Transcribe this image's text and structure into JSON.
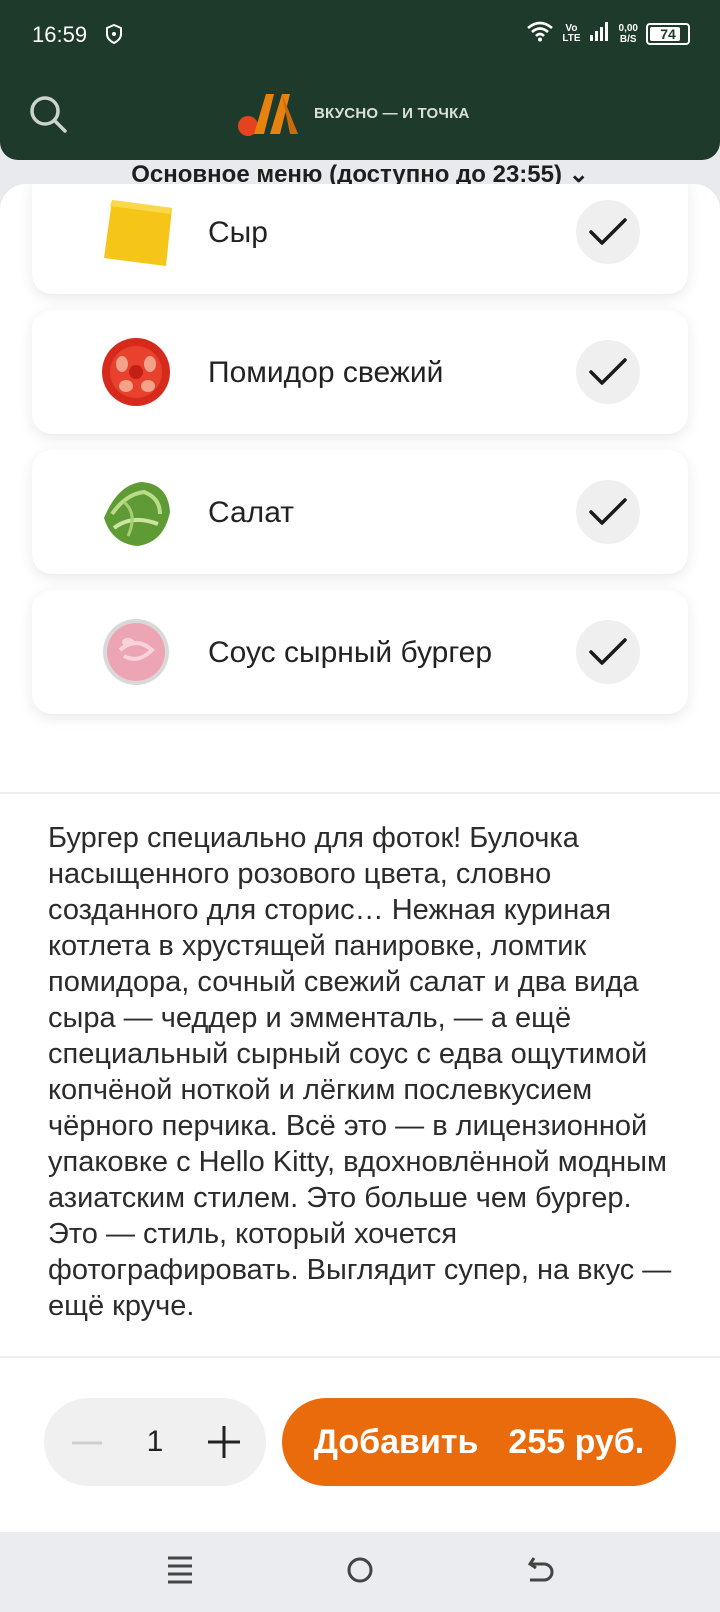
{
  "status_bar": {
    "time": "16:59",
    "network_top": "Vo",
    "network_bottom": "LTE",
    "speed_top": "0,00",
    "speed_bottom": "B/S",
    "battery": "74"
  },
  "header": {
    "logo_text": "ВКУСНО — И ТОЧКА",
    "menu_title": "Основное меню (доступно до 23:55) ⌄"
  },
  "ingredients": [
    {
      "label": "Сыр",
      "icon": "cheese-image",
      "checked": true
    },
    {
      "label": "Помидор свежий",
      "icon": "tomato-image",
      "checked": true
    },
    {
      "label": "Салат",
      "icon": "lettuce-image",
      "checked": true
    },
    {
      "label": "Соус сырный бургер",
      "icon": "sauce-image",
      "checked": true
    }
  ],
  "description": "Бургер специально для фоток! Булочка насыщенного розового цвета, словно созданного для сторис… Нежная куриная котлета в хрустящей панировке, ломтик помидора, сочный свежий салат и два вида сыра — чеддер и эмменталь, — а ещё специальный сырный соус с едва ощутимой копчёной ноткой и лёгким послевкусием чёрного перчика. Всё это — в лицензионной упаковке с Hello Kitty, вдохновлённой модным азиатским стилем. Это больше чем бургер. Это — стиль, который хочется фотографировать. Выглядит супер, на вкус — ещё круче.",
  "order": {
    "quantity": "1",
    "add_label": "Добавить",
    "price": "255 руб."
  },
  "colors": {
    "header_bg": "#1e3a2b",
    "accent": "#ea6b0b"
  }
}
